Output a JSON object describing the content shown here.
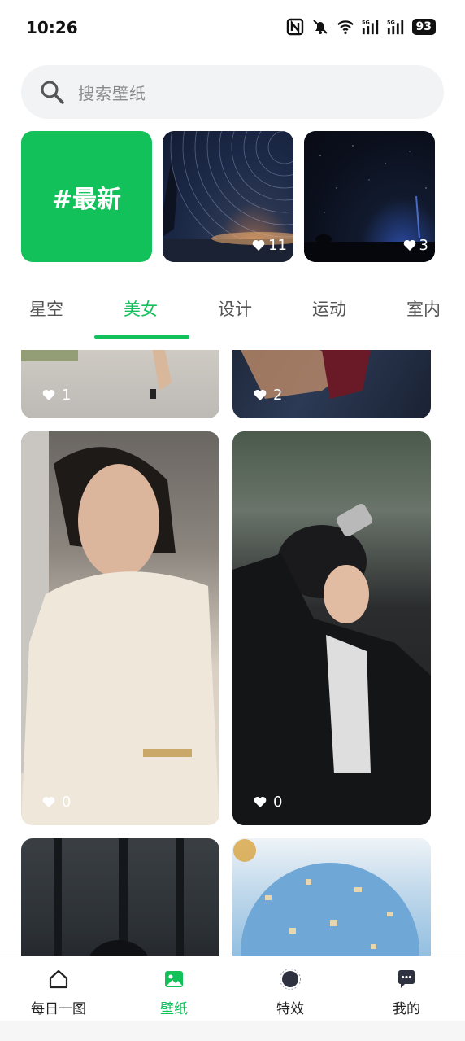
{
  "status_bar": {
    "time": "10:26",
    "battery": "93",
    "icons": [
      "nfc-icon",
      "mute-icon",
      "wifi-icon",
      "signal-5g-icon",
      "signal-5g-icon"
    ]
  },
  "search": {
    "placeholder": "搜索壁纸"
  },
  "featured": {
    "latest_label": "#最新",
    "items": [
      {
        "likes": "11"
      },
      {
        "likes": "3"
      }
    ]
  },
  "tabs": [
    {
      "label": "星空"
    },
    {
      "label": "美女",
      "active": true
    },
    {
      "label": "设计"
    },
    {
      "label": "运动"
    },
    {
      "label": "室内"
    }
  ],
  "grid": {
    "items": [
      {
        "likes": "1"
      },
      {
        "likes": "2"
      },
      {
        "likes": "0"
      },
      {
        "likes": "0"
      }
    ]
  },
  "bottom_nav": {
    "items": [
      {
        "label": "每日一图",
        "icon": "home-icon"
      },
      {
        "label": "壁纸",
        "icon": "image-icon",
        "active": true
      },
      {
        "label": "特效",
        "icon": "circle-icon"
      },
      {
        "label": "我的",
        "icon": "chat-icon"
      }
    ]
  },
  "colors": {
    "accent": "#12c15a",
    "search_bg": "#f2f3f5",
    "text": "#222222",
    "muted": "#8a8a8a"
  }
}
